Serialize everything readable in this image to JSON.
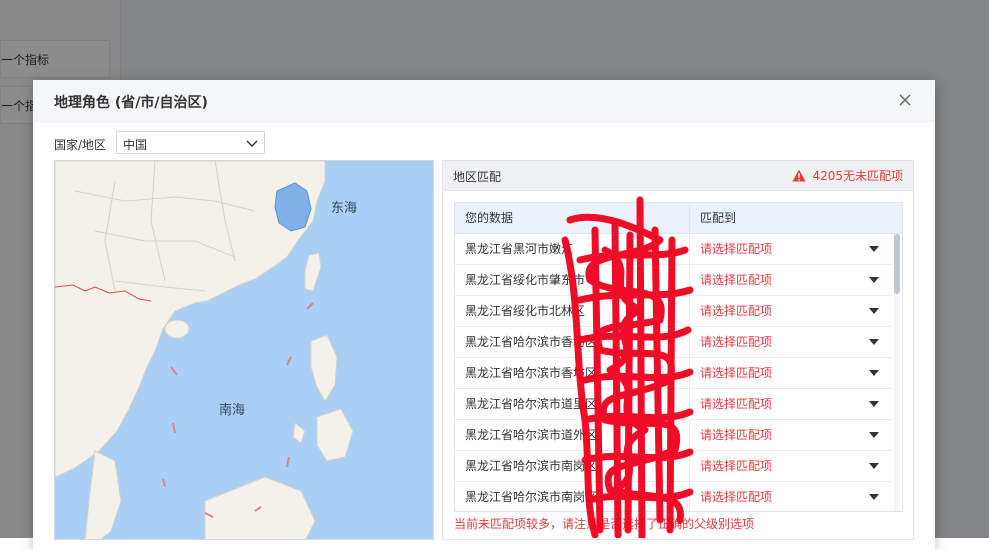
{
  "background": {
    "items": [
      "一个指标",
      "一个指"
    ]
  },
  "modal": {
    "title": "地理角色 (省/市/自治区)",
    "country_label": "国家/地区",
    "country_value": "中国"
  },
  "map": {
    "labels": [
      "东海",
      "南海"
    ]
  },
  "match_panel": {
    "title": "地区匹配",
    "warning": "4205无未匹配项",
    "columns": [
      "您的数据",
      "匹配到"
    ],
    "rows": [
      {
        "data": "黑龙江省黑河市嫩江",
        "match": "请选择匹配项"
      },
      {
        "data": "黑龙江省绥化市肇东市",
        "match": "请选择匹配项"
      },
      {
        "data": "黑龙江省绥化市北林区",
        "match": "请选择匹配项"
      },
      {
        "data": "黑龙江省哈尔滨市香坊区",
        "match": "请选择匹配项"
      },
      {
        "data": "黑龙江省哈尔滨市香坊区",
        "match": "请选择匹配项"
      },
      {
        "data": "黑龙江省哈尔滨市道里区",
        "match": "请选择匹配项"
      },
      {
        "data": "黑龙江省哈尔滨市道外区",
        "match": "请选择匹配项"
      },
      {
        "data": "黑龙江省哈尔滨市南岗区",
        "match": "请选择匹配项"
      },
      {
        "data": "黑龙江省哈尔滨市南岗区",
        "match": "请选择匹配项"
      }
    ],
    "footer_note": "当前未匹配项较多，请注意是否选择了正确的父级别选项"
  },
  "colors": {
    "accent_red": "#e83c3c",
    "highlight_blue": "#7fb0e6",
    "sea": "#a9cff5",
    "land": "#f4f1ea"
  }
}
